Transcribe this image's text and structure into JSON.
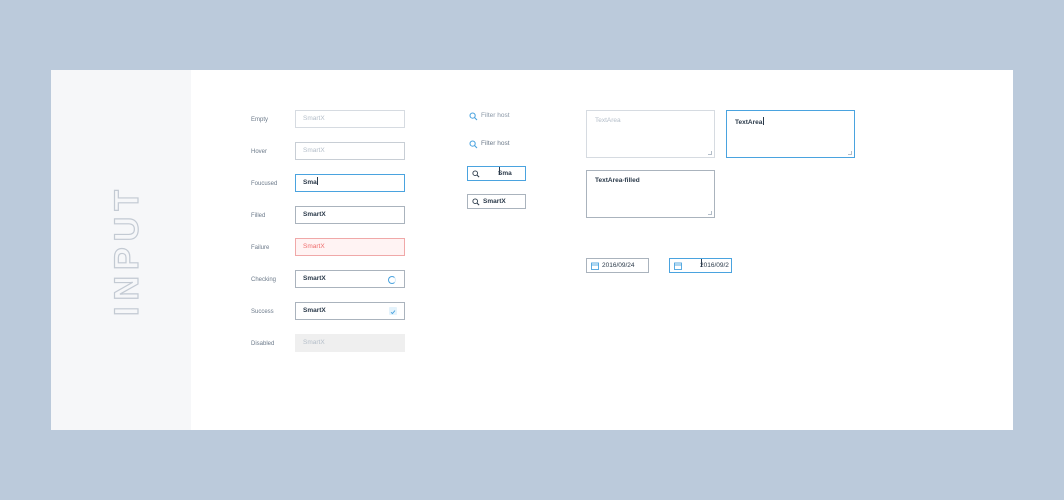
{
  "sidebar": {
    "title": "INPUT"
  },
  "states": [
    {
      "label": "Empty",
      "value": "SmartX"
    },
    {
      "label": "Hover",
      "value": "SmartX"
    },
    {
      "label": "Foucused",
      "value": "Sma"
    },
    {
      "label": "Filled",
      "value": "SmartX"
    },
    {
      "label": "Failure",
      "value": "SmartX"
    },
    {
      "label": "Checking",
      "value": "SmartX"
    },
    {
      "label": "Success",
      "value": "SmartX"
    },
    {
      "label": "Disabled",
      "value": "SmartX"
    }
  ],
  "search": {
    "placeholder_1": "Filter host",
    "placeholder_2": "Filter host",
    "focused_value": "Sma",
    "filled_value": "SmartX"
  },
  "textarea": {
    "placeholder": "TextArea",
    "focused_value": "TextArea",
    "filled_value": "TextArea-filled"
  },
  "date": {
    "filled_value": "2016/09/24",
    "focused_value": "2016/09/2"
  },
  "colors": {
    "background": "#bbcadb",
    "accent": "#4aa3df",
    "error": "#ef6d6d",
    "sidebar": "#f6f7f9"
  }
}
